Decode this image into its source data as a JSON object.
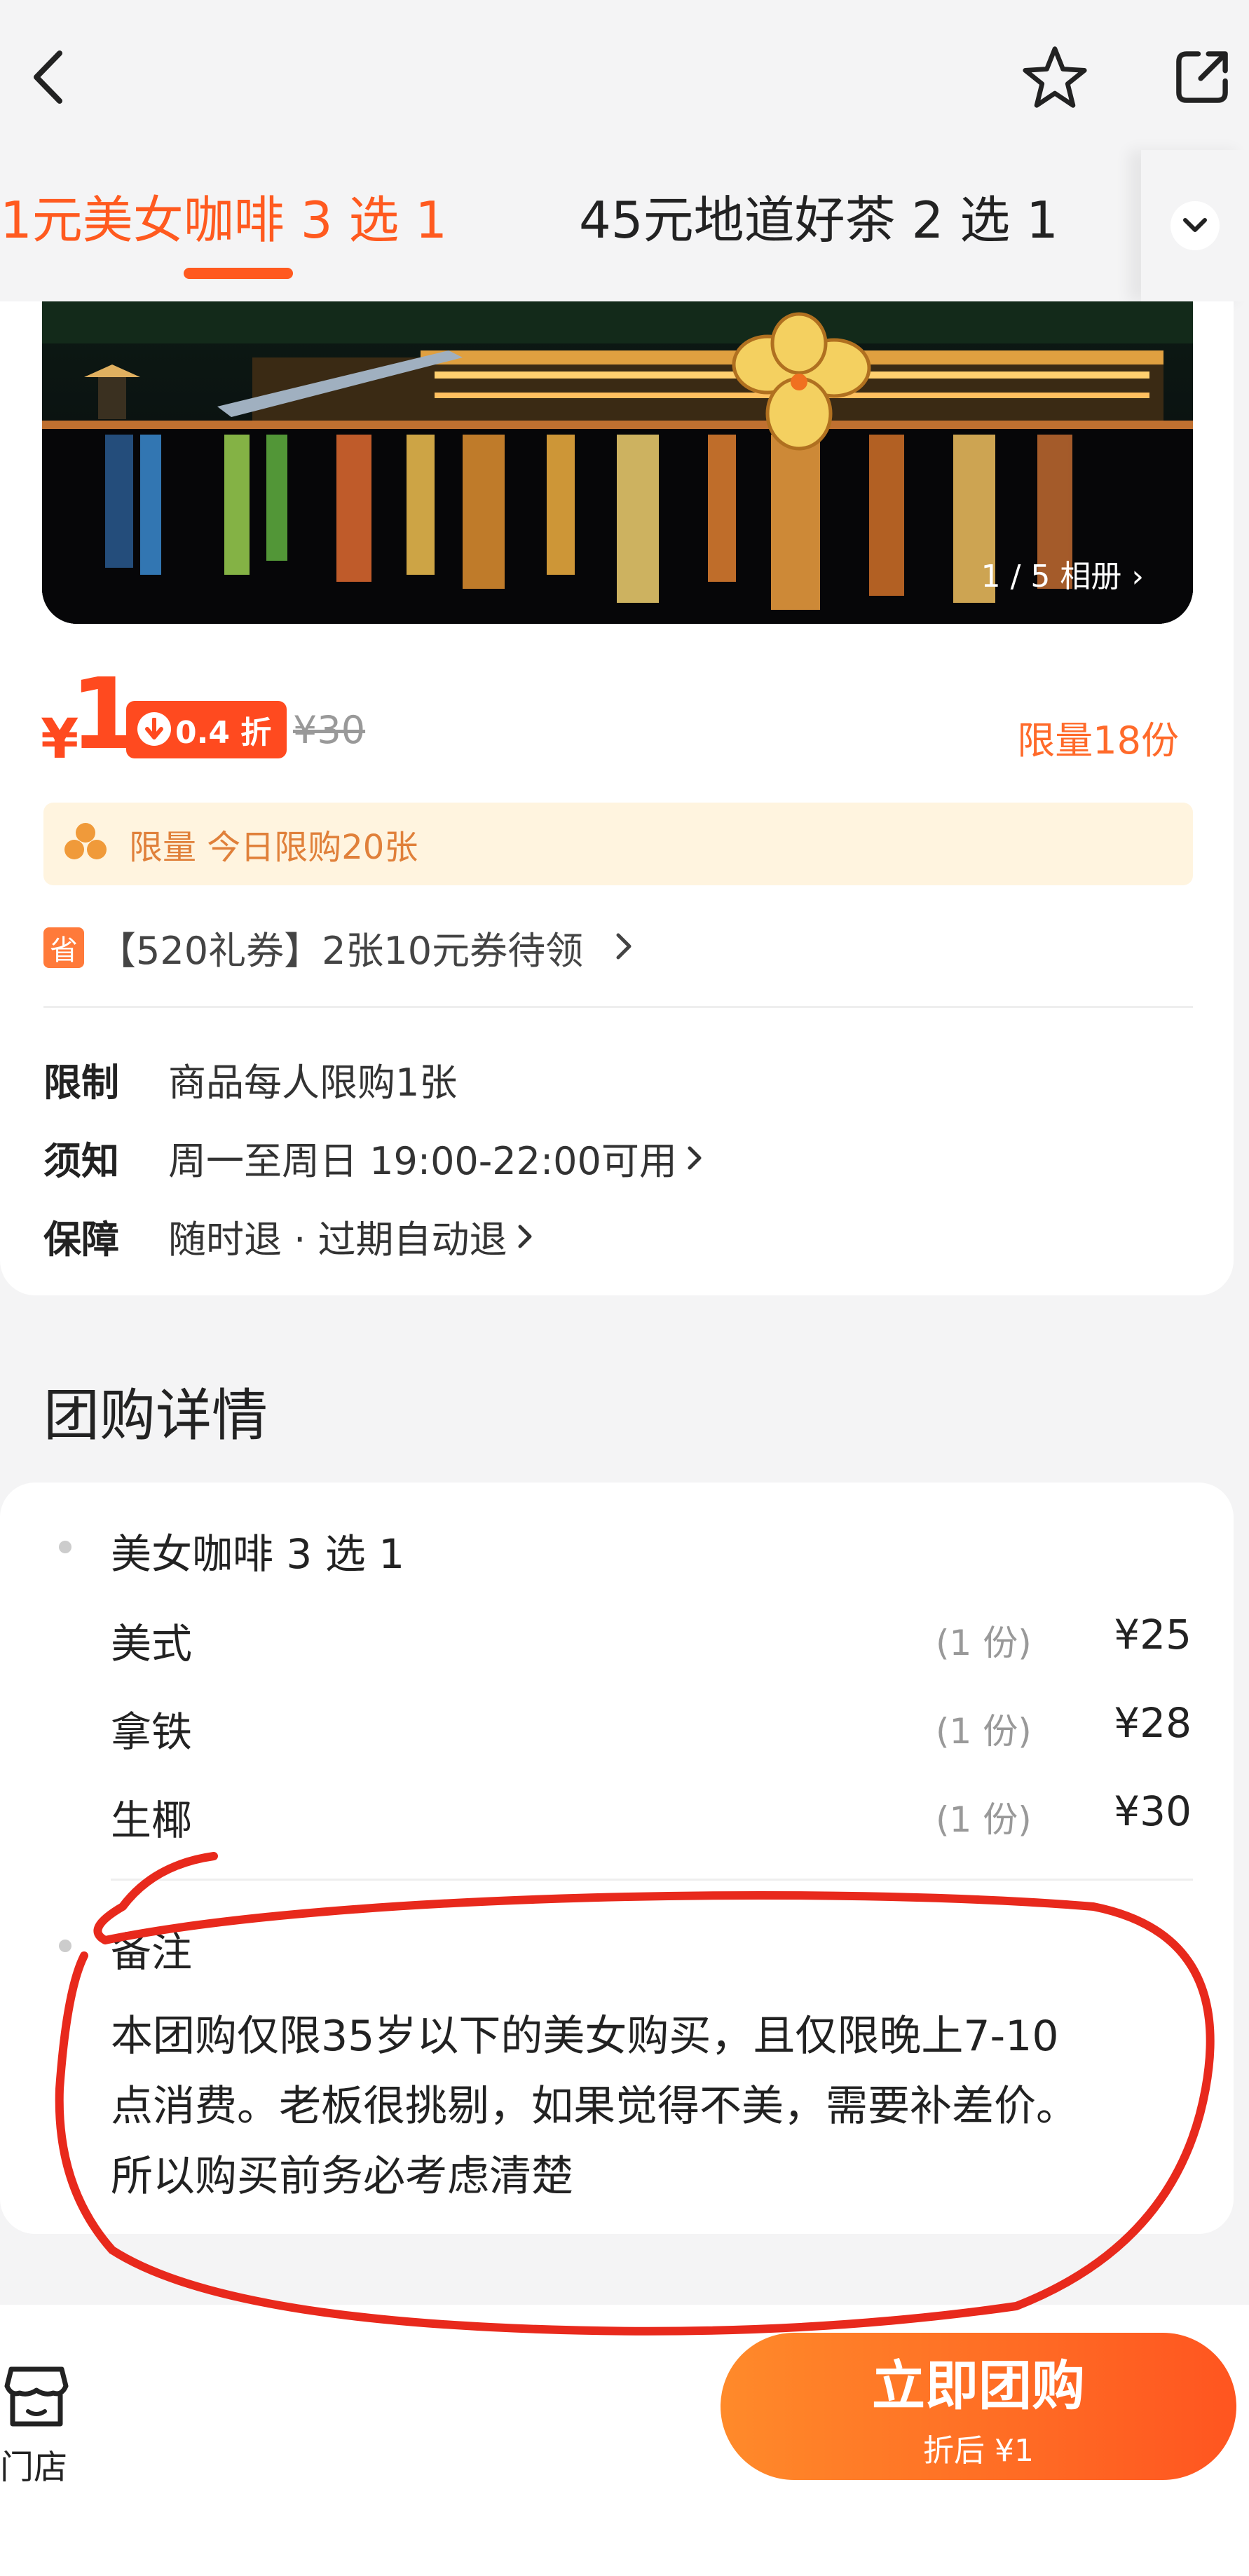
{
  "tabs": [
    {
      "label": "1元美女咖啡 3 选 1"
    },
    {
      "label": "45元地道好茶 2 选 1"
    }
  ],
  "photo": {
    "album_label": "1 / 5 相册"
  },
  "price": {
    "symbol": "¥",
    "value": "1",
    "discount": "0.4 折",
    "original": "¥30",
    "limit_quantity": "限量18份"
  },
  "banner": {
    "text": "限量  今日限购20张"
  },
  "coupon": {
    "tag": "省",
    "text": "【520礼券】2张10元券待领"
  },
  "rules": [
    {
      "key": "限制",
      "value": "商品每人限购1张"
    },
    {
      "key": "须知",
      "value": "周一至周日 19:00-22:00可用"
    },
    {
      "key": "保障",
      "value": "随时退 · 过期自动退"
    }
  ],
  "details": {
    "section_title": "团购详情",
    "group_name": "美女咖啡 3 选 1",
    "items": [
      {
        "name": "美式",
        "qty": "(1 份)",
        "price": "¥25"
      },
      {
        "name": "拿铁",
        "qty": "(1 份)",
        "price": "¥28"
      },
      {
        "name": "生椰",
        "qty": "(1 份)",
        "price": "¥30"
      }
    ],
    "remark_title": "备注",
    "remark_lines": [
      "本团购仅限35岁以下的美女购买，且仅限晚上7-10",
      "点消费。老板很挑剔，如果觉得不美，需要补差价。",
      "所以购买前务必考虑清楚"
    ]
  },
  "bottom": {
    "store_label": "门店",
    "buy_label": "立即团购",
    "buy_sub": "折后 ¥1"
  },
  "colors": {
    "accent": "#ff5a1f",
    "price": "#ff4a1f",
    "banner_bg": "#fff4df",
    "annotation": "#e8291c"
  },
  "icons": [
    "back-icon",
    "star-icon",
    "share-icon",
    "chevron-down-icon",
    "discount-arrow-icon",
    "clover-icon",
    "store-icon",
    "chevron-right-icon"
  ]
}
